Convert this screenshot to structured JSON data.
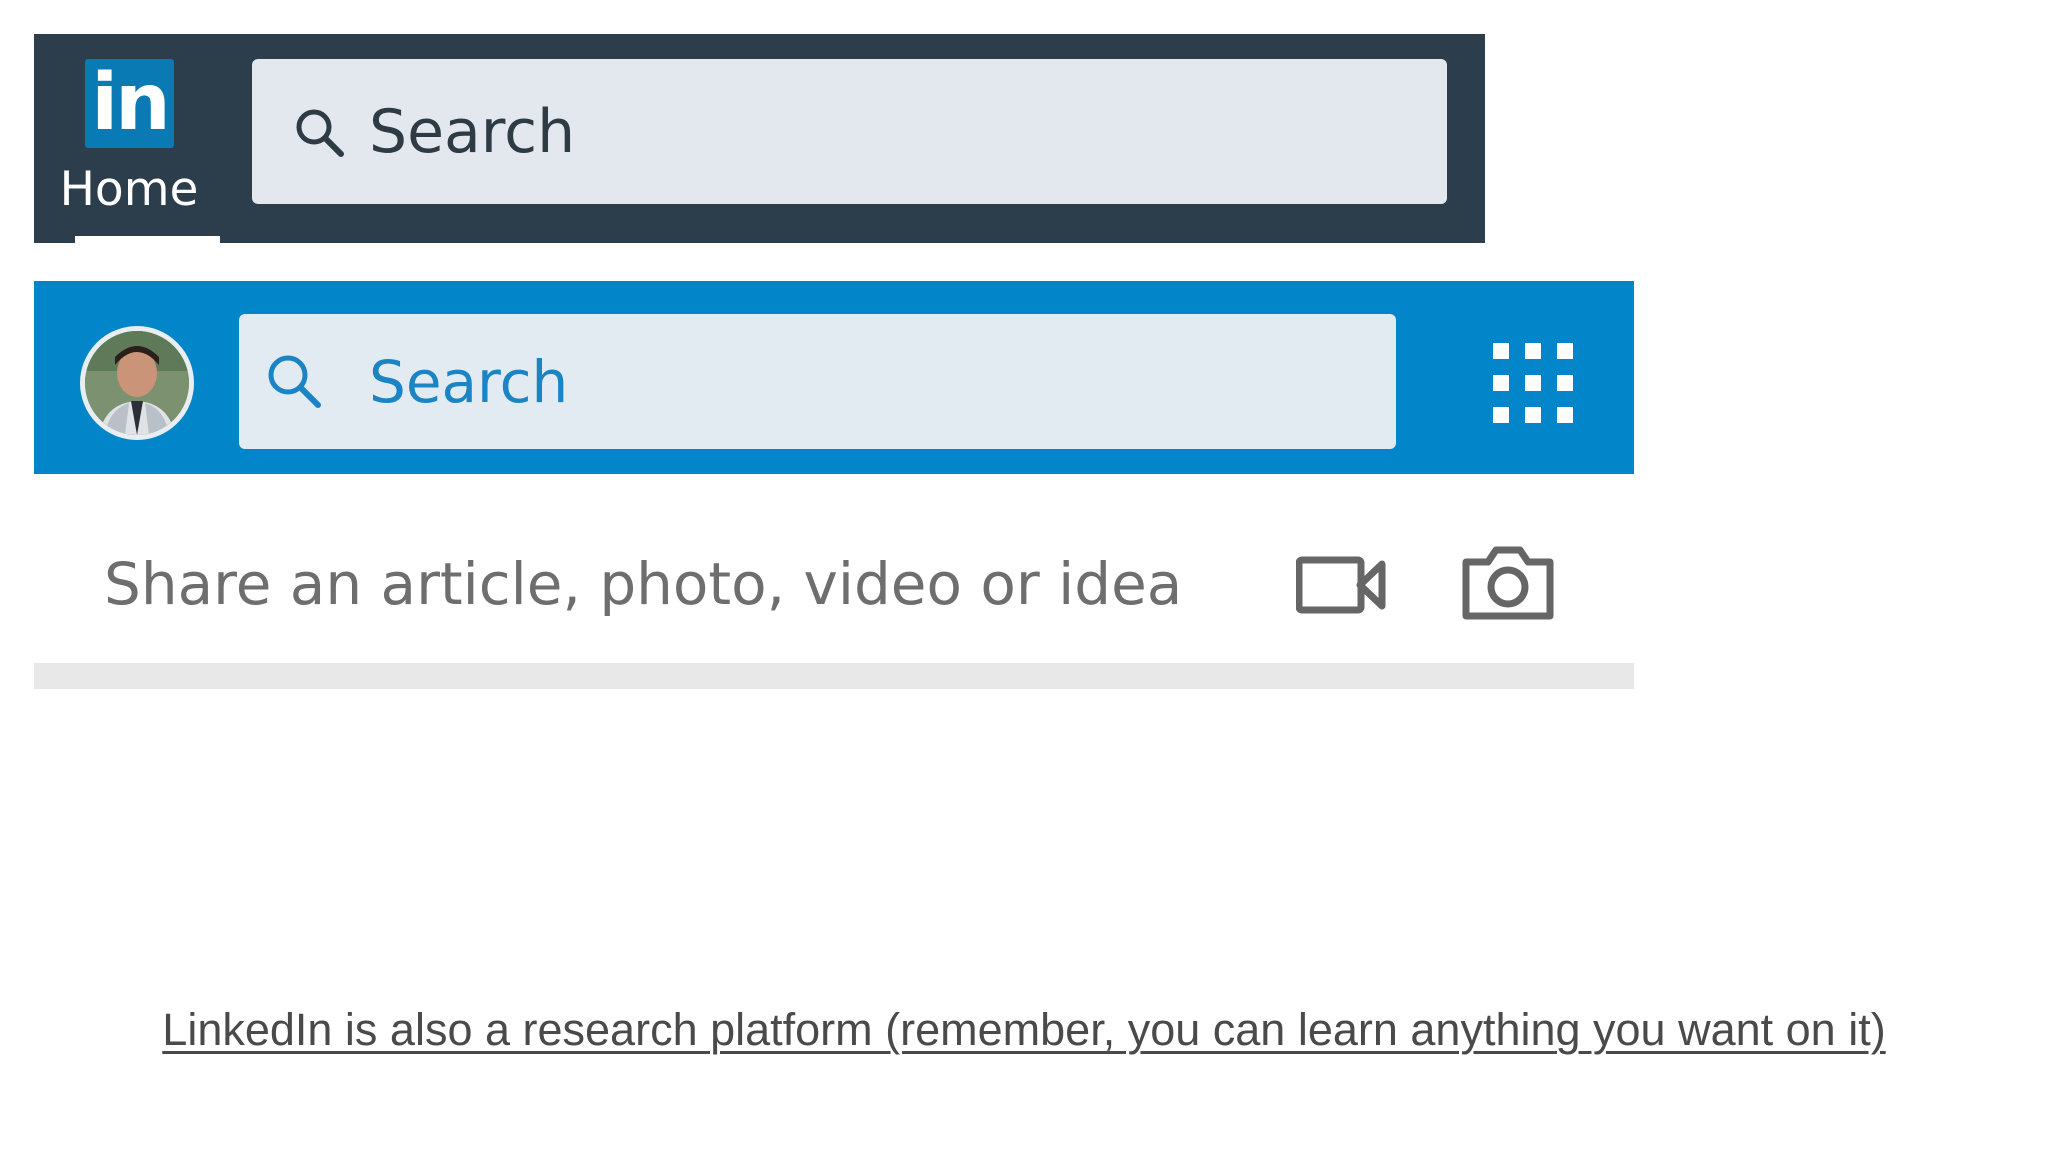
{
  "old_header": {
    "logo_text": "in",
    "home_label": "Home",
    "search_placeholder": "Search",
    "colors": {
      "bar": "#2c3e4c",
      "logo": "#0a7ab5",
      "search_field": "#e3e8ee"
    }
  },
  "new_header": {
    "search_placeholder": "Search",
    "colors": {
      "bar": "#0286c9",
      "search_field": "#e3ebf2",
      "search_text": "#1a84c4"
    },
    "icons": [
      "avatar",
      "search-icon",
      "apps-grid-icon"
    ]
  },
  "share_box": {
    "prompt": "Share an article, photo, video or idea",
    "icons": [
      "video-camera-icon",
      "photo-camera-icon"
    ]
  },
  "caption": {
    "text": "LinkedIn is also a research platform (remember, you can learn anything you want on it)"
  }
}
